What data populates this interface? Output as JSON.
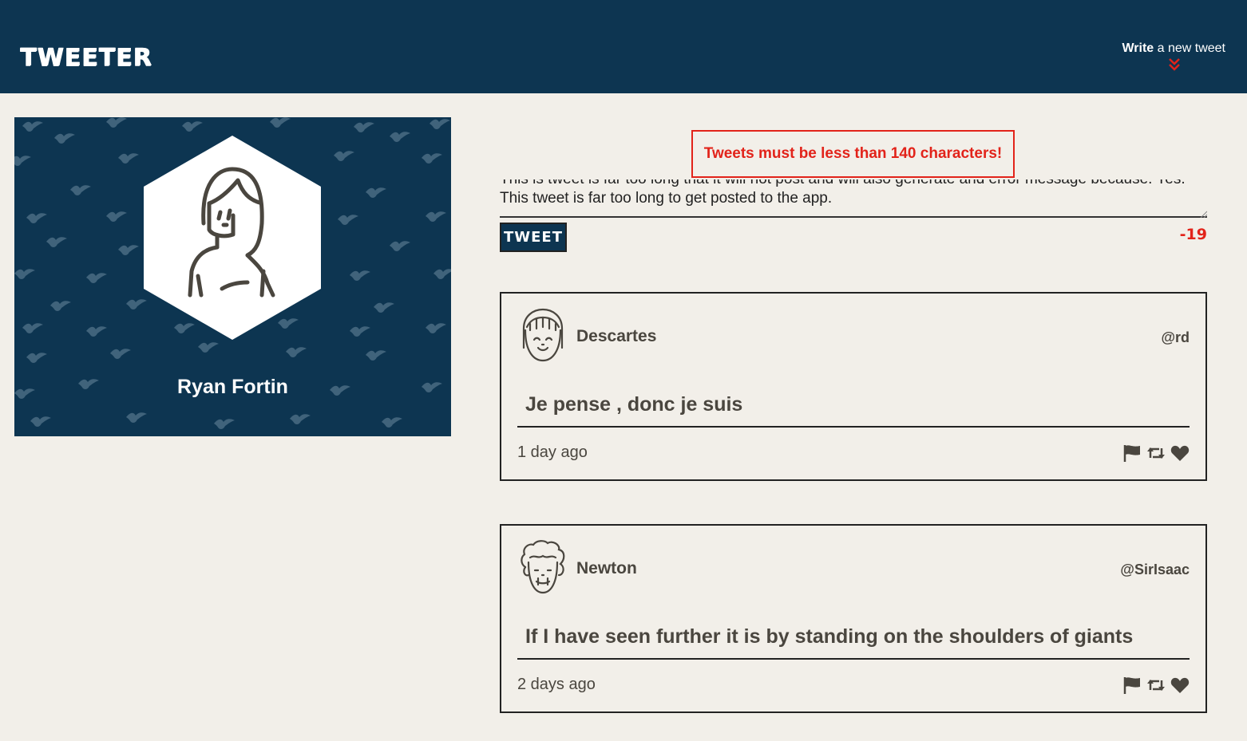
{
  "nav": {
    "brand": "TWEETER",
    "compose_bold": "Write",
    "compose_rest": " a new tweet"
  },
  "profile": {
    "name": "Ryan Fortin"
  },
  "composer": {
    "error_message": "Tweets must be less than 140 characters!",
    "text_line1": "This is tweet is far too long that it will not post and will also generate and error message because. Yes.",
    "text_line2": "This tweet is far too long to get posted to the app.",
    "button_label": "TWEET",
    "char_counter": "-19"
  },
  "tweets": [
    {
      "author": "Descartes",
      "handle": "@rd",
      "content": "Je pense , donc je suis",
      "time": "1 day ago"
    },
    {
      "author": "Newton",
      "handle": "@SirIsaac",
      "content": "If I have seen further it is by standing on the shoulders of giants",
      "time": "2 days ago"
    }
  ],
  "colors": {
    "nav_bg": "#0d3551",
    "page_bg": "#f2efe9",
    "error_red": "#e2231a",
    "text": "#4a463f"
  },
  "icons": [
    "flag-icon",
    "retweet-icon",
    "heart-icon",
    "chevron-down-icon"
  ]
}
